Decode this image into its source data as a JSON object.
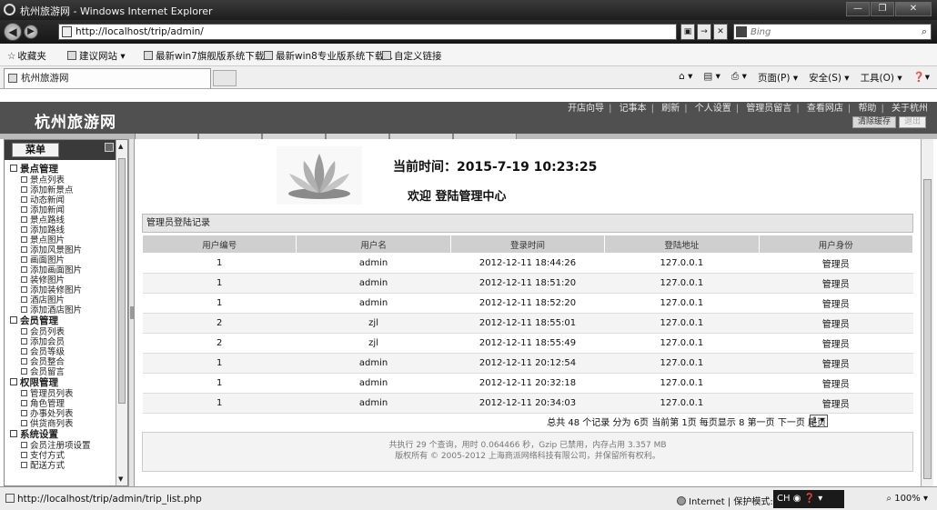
{
  "browser": {
    "window_title": "杭州旅游网 - Windows Internet Explorer",
    "url": "http://localhost/trip/admin/",
    "search_placeholder": "Bing",
    "favorites": [
      "收藏夹",
      "建议网站 ▾",
      "最新win7旗舰版系统下载...",
      "最新win8专业版系统下载...",
      "自定义链接"
    ],
    "tab_title": "杭州旅游网",
    "commands": [
      "▾",
      "▾",
      "▾",
      "页面(P) ▾",
      "安全(S) ▾",
      "工具(O) ▾",
      "▾"
    ],
    "status_url": "http://localhost/trip/admin/trip_list.php",
    "status_zone": "Internet | 保护模式: 禁",
    "ime": "CH",
    "zoom": "100%"
  },
  "site": {
    "logo": "杭州旅游网",
    "top_links": [
      "开店向导",
      "记事本",
      "刷新",
      "个人设置",
      "管理员留言",
      "查看网店",
      "帮助",
      "关于杭州"
    ],
    "header_buttons": [
      "清除缓存",
      "退出"
    ]
  },
  "sidebar": {
    "menu_label": "菜单",
    "groups": [
      {
        "title": "景点管理",
        "items": [
          "景点列表",
          "添加新景点",
          "动态新闻",
          "添加新闻",
          "景点路线",
          "添加路线",
          "景点图片",
          "添加风景图片",
          "画面图片",
          "添加画面图片",
          "装修图片",
          "添加装修图片",
          "酒店图片",
          "添加酒店图片"
        ]
      },
      {
        "title": "会员管理",
        "items": [
          "会员列表",
          "添加会员",
          "会员等级",
          "会员整合",
          "会员留言"
        ]
      },
      {
        "title": "权限管理",
        "items": [
          "管理员列表",
          "角色管理",
          "办事处列表",
          "供货商列表"
        ]
      },
      {
        "title": "系统设置",
        "items": [
          "会员注册项设置",
          "支付方式",
          "配送方式"
        ]
      }
    ]
  },
  "main": {
    "time_label": "当前时间：2015-7-19 10:23:25",
    "welcome": "欢迎  登陆管理中心",
    "panel_title": "管理员登陆记录",
    "columns": [
      "用户编号",
      "用户名",
      "登录时间",
      "登陆地址",
      "用户身份"
    ],
    "rows": [
      [
        "1",
        "admin",
        "2012-12-11 18:44:26",
        "127.0.0.1",
        "管理员"
      ],
      [
        "1",
        "admin",
        "2012-12-11 18:51:20",
        "127.0.0.1",
        "管理员"
      ],
      [
        "1",
        "admin",
        "2012-12-11 18:52:20",
        "127.0.0.1",
        "管理员"
      ],
      [
        "2",
        "zjl",
        "2012-12-11 18:55:01",
        "127.0.0.1",
        "管理员"
      ],
      [
        "2",
        "zjl",
        "2012-12-11 18:55:49",
        "127.0.0.1",
        "管理员"
      ],
      [
        "1",
        "admin",
        "2012-12-11 20:12:54",
        "127.0.0.1",
        "管理员"
      ],
      [
        "1",
        "admin",
        "2012-12-11 20:32:18",
        "127.0.0.1",
        "管理员"
      ],
      [
        "1",
        "admin",
        "2012-12-11 20:34:03",
        "127.0.0.1",
        "管理员"
      ]
    ],
    "pager_text": "总共 48 个记录 分为 6页 当前第 1页 每页显示 8 第一页 下一页 尾页",
    "page_select": "1",
    "footer_line1": "共执行 29 个查询，用时 0.064466 秒，Gzip 已禁用，内存占用 3.357 MB",
    "footer_line2": "版权所有 © 2005-2012 上海商派网络科技有限公司，并保留所有权利。"
  }
}
